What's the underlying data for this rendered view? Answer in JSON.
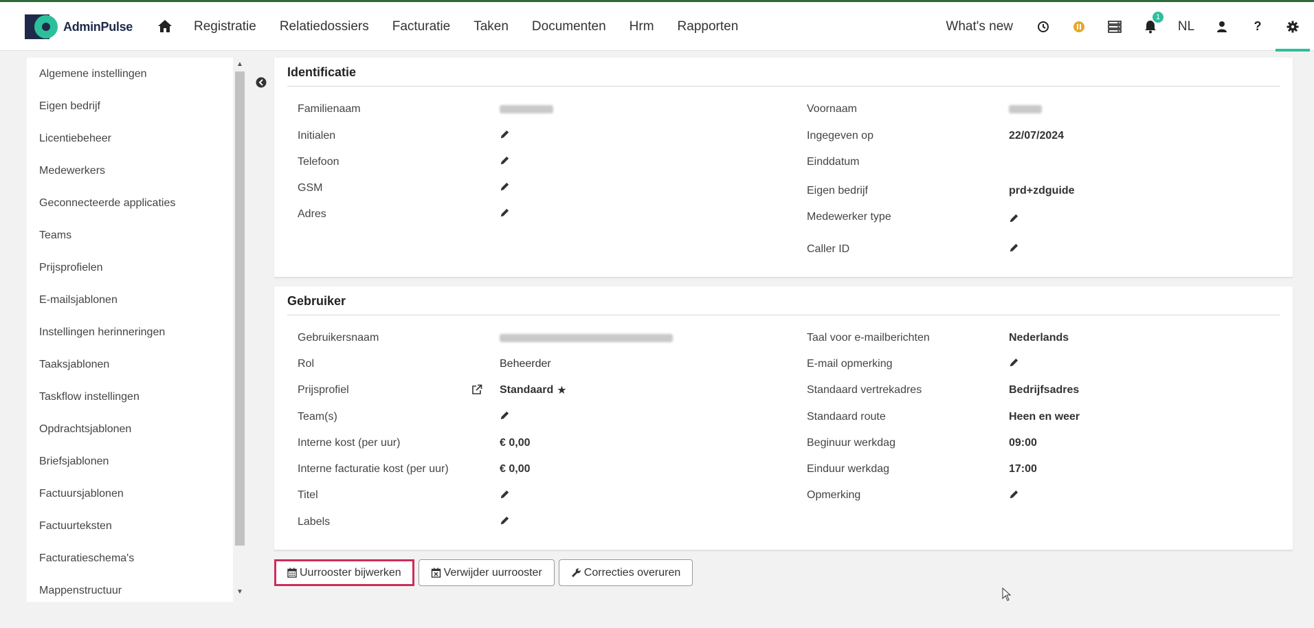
{
  "app": {
    "name": "AdminPulse"
  },
  "nav": {
    "items": [
      "Registratie",
      "Relatiedossiers",
      "Facturatie",
      "Taken",
      "Documenten",
      "Hrm",
      "Rapporten"
    ],
    "whats_new": "What's new",
    "language": "NL",
    "notification_count": "1",
    "icons": [
      "home-icon",
      "clock-icon",
      "pause-status-icon",
      "server-icon",
      "bell-icon",
      "user-icon",
      "help-icon",
      "gear-icon"
    ]
  },
  "sidebar": {
    "items": [
      "Algemene instellingen",
      "Eigen bedrijf",
      "Licentiebeheer",
      "Medewerkers",
      "Geconnecteerde applicaties",
      "Teams",
      "Prijsprofielen",
      "E-mailsjablonen",
      "Instellingen herinneringen",
      "Taaksjablonen",
      "Taskflow instellingen",
      "Opdrachtsjablonen",
      "Briefsjablonen",
      "Factuursjablonen",
      "Factuurteksten",
      "Facturatieschema's",
      "Mappenstructuur"
    ]
  },
  "identificatie": {
    "title": "Identificatie",
    "left": {
      "familienaam_label": "Familienaam",
      "initialen_label": "Initialen",
      "telefoon_label": "Telefoon",
      "gsm_label": "GSM",
      "adres_label": "Adres"
    },
    "right": {
      "voornaam_label": "Voornaam",
      "ingegeven_label": "Ingegeven op",
      "ingegeven_value": "22/07/2024",
      "einddatum_label": "Einddatum",
      "eigen_bedrijf_label": "Eigen bedrijf",
      "eigen_bedrijf_value": "prd+zdguide",
      "medewerker_type_label": "Medewerker type",
      "caller_id_label": "Caller ID"
    }
  },
  "gebruiker": {
    "title": "Gebruiker",
    "left": {
      "gebruikersnaam_label": "Gebruikersnaam",
      "rol_label": "Rol",
      "rol_value": "Beheerder",
      "prijsprofiel_label": "Prijsprofiel",
      "prijsprofiel_value": "Standaard",
      "teams_label": "Team(s)",
      "interne_kost_label": "Interne kost (per uur)",
      "interne_kost_value": "€ 0,00",
      "interne_fact_label": "Interne facturatie kost (per uur)",
      "interne_fact_value": "€ 0,00",
      "titel_label": "Titel",
      "labels_label": "Labels"
    },
    "right": {
      "taal_label": "Taal voor e-mailberichten",
      "taal_value": "Nederlands",
      "email_opmerking_label": "E-mail opmerking",
      "vertrekadres_label": "Standaard vertrekadres",
      "vertrekadres_value": "Bedrijfsadres",
      "route_label": "Standaard route",
      "route_value": "Heen en weer",
      "beginuur_label": "Beginuur werkdag",
      "beginuur_value": "09:00",
      "einduur_label": "Einduur werkdag",
      "einduur_value": "17:00",
      "opmerking_label": "Opmerking"
    }
  },
  "actions": {
    "uurrooster_bijwerken": "Uurrooster bijwerken",
    "verwijder_uurrooster": "Verwijder uurrooster",
    "correcties_overuren": "Correcties overuren"
  },
  "colors": {
    "accent": "#2dbf9b",
    "brand_dark": "#1f2a4a",
    "highlight": "#cc2d5a",
    "status_pause": "#e5a82c"
  }
}
